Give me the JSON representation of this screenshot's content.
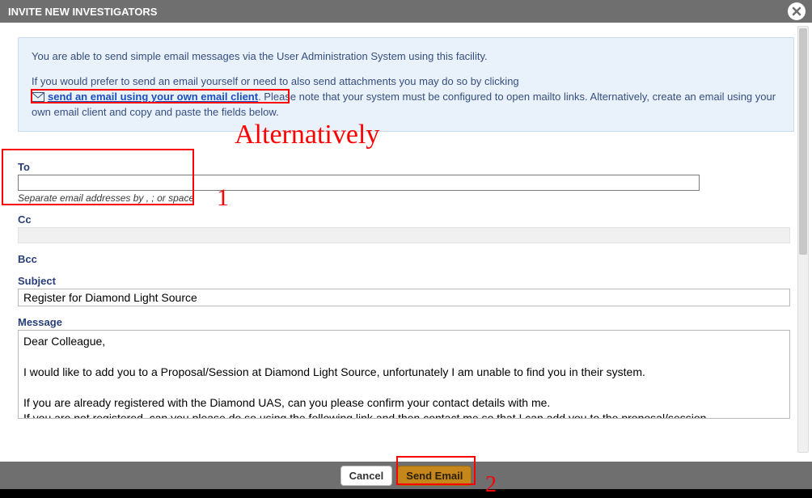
{
  "header": {
    "title": "INVITE NEW INVESTIGATORS"
  },
  "info": {
    "line1": "You are able to send simple email messages via the User Administration System using this facility.",
    "line2_a": "If you would prefer to send an email yourself or need to also send attachments you may do so by clicking",
    "link_text": "send an email using your own email client",
    "line2_b": ". Please note that your system must be configured to open mailto links. Alternatively, create an email using your own email client and copy and paste the fields below."
  },
  "form": {
    "to_label": "To",
    "to_hint": "Separate email addresses by , ; or space",
    "cc_label": "Cc",
    "bcc_label": "Bcc",
    "subject_label": "Subject",
    "subject_value": "Register for Diamond Light Source",
    "message_label": "Message",
    "message_value": "Dear Colleague,\n\nI would like to add you to a Proposal/Session at Diamond Light Source, unfortunately I am unable to find you in their system.\n\nIf you are already registered with the Diamond UAS, can you please confirm your contact details with me.\nIf you are not registered, can you please do so using the following link and then contact me so that I can add you to the proposal/session."
  },
  "buttons": {
    "cancel": "Cancel",
    "send": "Send Email"
  },
  "annotations": {
    "alt": "Alternatively",
    "one": "1",
    "two": "2"
  }
}
